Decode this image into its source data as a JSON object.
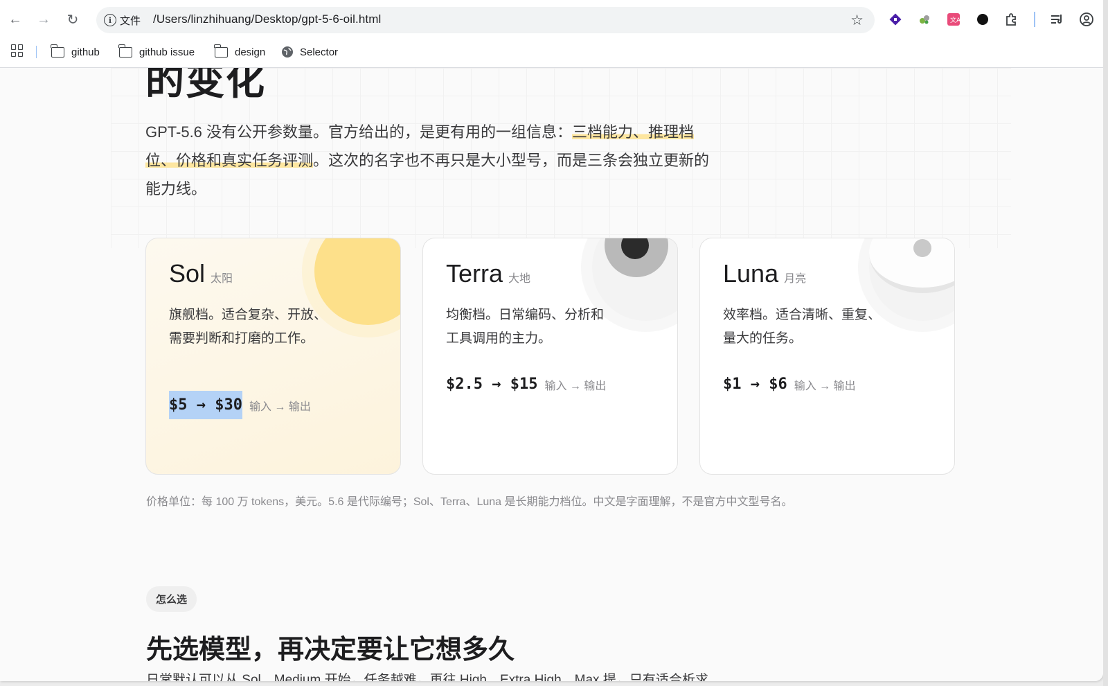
{
  "browser": {
    "url_chip": "文件",
    "url": "/Users/linzhihuang/Desktop/gpt-5-6-oil.html"
  },
  "bookmarks": [
    {
      "label": "github"
    },
    {
      "label": "github issue"
    },
    {
      "label": "design"
    },
    {
      "label": "Selector"
    }
  ],
  "page": {
    "hero_title": "的变化",
    "intro_part1": "GPT-5.6 没有公开参数量。官方给出的，是更有用的一组信息：",
    "intro_hl1": "三档能力、推理档",
    "intro_hl2": "位、价格和真实任务评测",
    "intro_part2": "。这次的名字也不再只是大小型号，而是三条会独立更新的",
    "intro_part3": "能力线。",
    "cards": [
      {
        "name": "Sol",
        "sub": "太阳",
        "desc": "旗舰档。适合复杂、开放、需要判断和打磨的工作。",
        "price": "$5 → $30",
        "note": "输入 → 输出"
      },
      {
        "name": "Terra",
        "sub": "大地",
        "desc": "均衡档。日常编码、分析和工具调用的主力。",
        "price": "$2.5 → $15",
        "note": "输入 → 输出"
      },
      {
        "name": "Luna",
        "sub": "月亮",
        "desc": "效率档。适合清晰、重复、量大的任务。",
        "price": "$1 → $6",
        "note": "输入 → 输出"
      }
    ],
    "footnote": "价格单位：每 100 万 tokens，美元。5.6 是代际编号；Sol、Terra、Luna 是长期能力档位。中文是字面理解，不是官方中文型号名。",
    "section_tag": "怎么选",
    "section_title": "先选模型，再决定要让它想多久",
    "cut_text": "日常默认可以从 Sol、Medium 开始，任务越难，再往 High、Extra High、Max 提，只有适合析求"
  },
  "colors": {
    "highlight": "#fde6a0",
    "sun": "#fde08a",
    "selection": "#b4d2f6"
  }
}
